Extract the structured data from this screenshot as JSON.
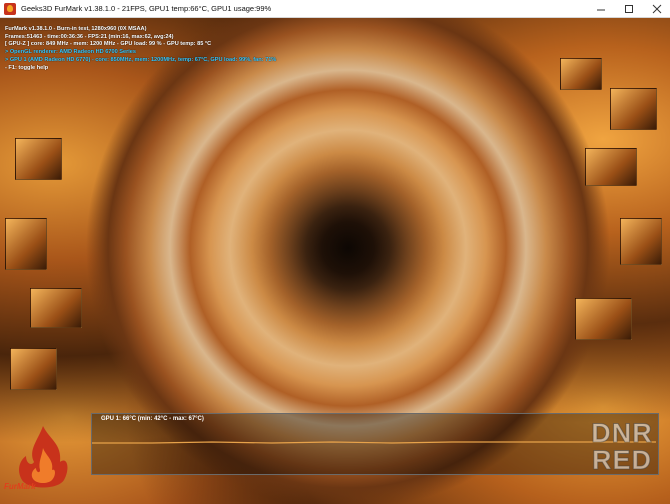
{
  "window": {
    "title": "Geeks3D FurMark v1.38.1.0 - 21FPS, GPU1 temp:66°C, GPU1 usage:99%",
    "minimize_icon": "minimize-icon",
    "maximize_icon": "maximize-icon",
    "close_icon": "close-icon"
  },
  "hud": {
    "lines": [
      "FurMark v1.38.1.0 - Burn-in test, 1280x960 (0X MSAA)",
      "Frames:51463 - time:00:36:36 - FPS:21 (min:16, max:62, avg:24)",
      "[ GPU-Z ] core: 849 MHz - mem: 1200 MHz - GPU load: 99 % - GPU temp: 85 °C",
      "> OpenGL renderer: AMD Radeon HD 6700 Series",
      "> GPU 1 (AMD Radeon HD 6770) - core: 850MHz, mem: 1200MHz, temp: 67°C, GPU load: 99%, fan: 71%",
      "- F1: toggle help"
    ]
  },
  "graph": {
    "label": "GPU 1: 66°C (min: 42°C - max: 67°C)",
    "line_color": "#e7a24a",
    "temperature_series": {
      "min": 42,
      "max": 67,
      "current": 66
    }
  },
  "logo": {
    "text": "FurMark"
  },
  "watermark": {
    "line1": "DNR",
    "line2": "RED"
  },
  "colors": {
    "hud_white": "#ffffff",
    "hud_cyan": "#35c8ff",
    "accent_orange": "#e0401c"
  }
}
